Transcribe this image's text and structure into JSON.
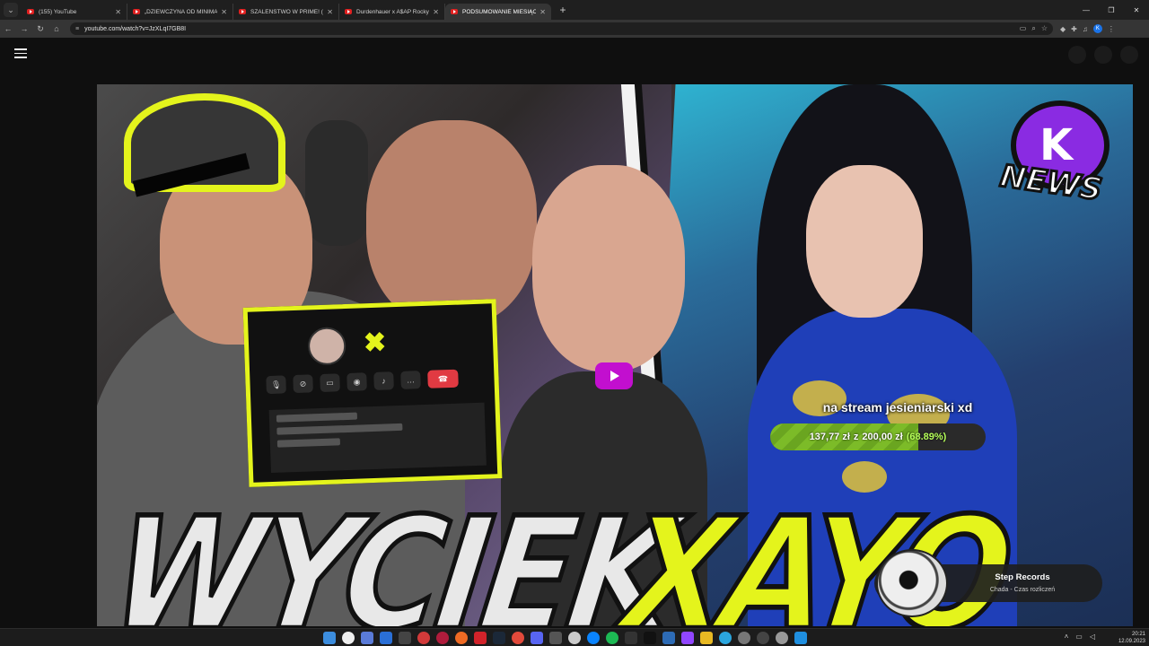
{
  "browser": {
    "tabs": [
      {
        "title": "(155) YouTube",
        "active": false
      },
      {
        "title": "„DZIEWCZYNA OD MINIMALIZ",
        "active": false
      },
      {
        "title": "SZALEŃSTWO W PRIME! (DEM",
        "active": false
      },
      {
        "title": "Durdenhauer x A$AP Rocky fea",
        "active": false
      },
      {
        "title": "PODSUMOWANIE MIESIĄCA! X",
        "active": true
      }
    ],
    "address": "youtube.com/watch?v=JzXLqI7GB8I",
    "profile_initial": "K"
  },
  "thumbnail": {
    "title_left": "WYCIEK",
    "title_right": "XAYO",
    "news_logo_text": "NEWS"
  },
  "donation_goal": {
    "title": "na stream jesieniarski xd",
    "raised": "137,77 zł",
    "separator": "z",
    "target": "200,00 zł",
    "percent_label": "(68.89%)",
    "progress_fraction": 0.6889
  },
  "now_playing": {
    "artist": "Step Records",
    "track": "Chada - Czas rozliczeń"
  },
  "taskbar": {
    "time": "20:21",
    "date": "12.09.2023"
  },
  "colors": {
    "accent_yellow": "#e4f41c",
    "play_button": "#c20fcf",
    "goal_green": "#7cbb28"
  }
}
